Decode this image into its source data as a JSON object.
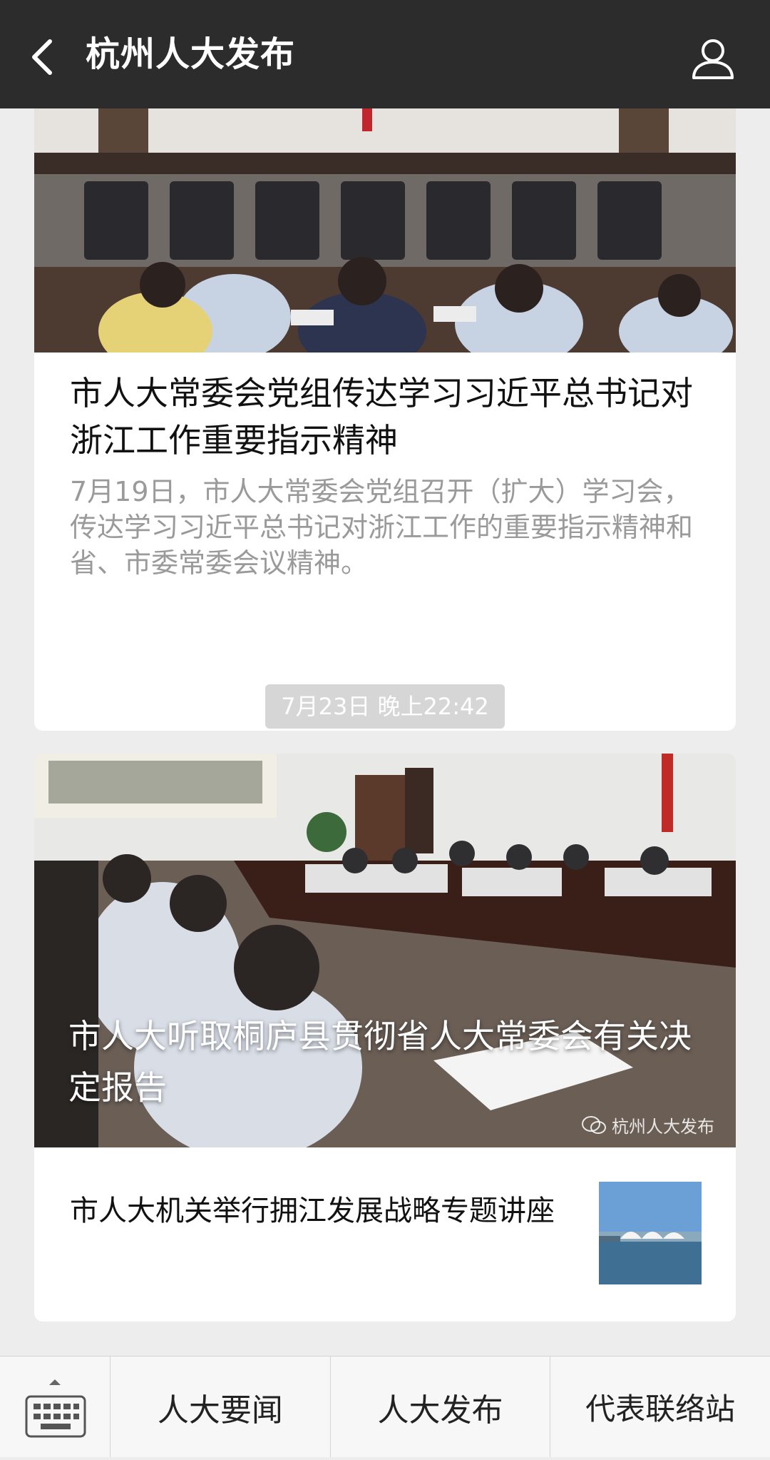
{
  "header": {
    "title": "杭州人大发布",
    "back_icon": "back-arrow-icon",
    "profile_icon": "user-profile-icon"
  },
  "articles": [
    {
      "title": "市人大常委会党组传达学习习近平总书记对浙江工作重要指示精神",
      "summary": "7月19日，市人大常委会党组召开（扩大）学习会，传达学习习近平总书记对浙江工作的重要指示精神和省、市委常委会议精神。"
    }
  ],
  "timestamp": "7月23日 晚上22:42",
  "digest": {
    "main_title": "市人大听取桐庐县贯彻省人大常委会有关决定报告",
    "watermark": "杭州人大发布",
    "sub_items": [
      {
        "title": "市人大机关举行拥江发展战略专题讲座"
      }
    ]
  },
  "menu": {
    "items": [
      "人大要闻",
      "人大发布",
      "代表联络站"
    ],
    "keyboard_icon": "keyboard-icon"
  },
  "colors": {
    "header_bg": "#2c2c2c",
    "page_bg": "#ededed",
    "timestamp_bg": "#d6d6d6"
  }
}
